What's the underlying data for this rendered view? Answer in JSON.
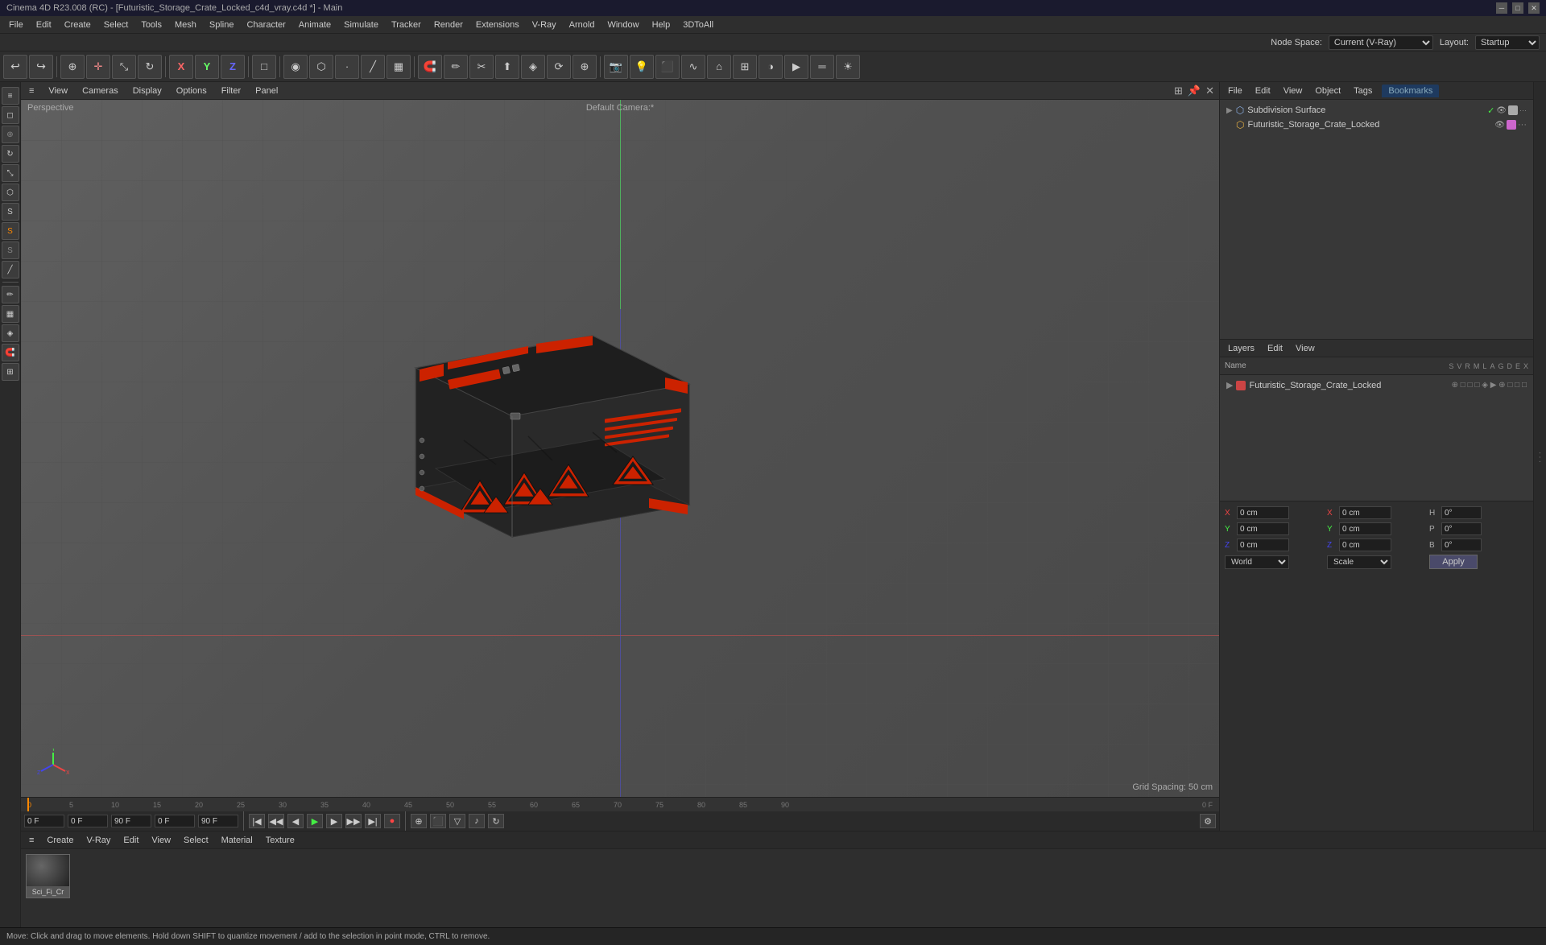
{
  "titleBar": {
    "title": "Cinema 4D R23.008 (RC) - [Futuristic_Storage_Crate_Locked_c4d_vray.c4d *] - Main",
    "controls": [
      "minimize",
      "maximize",
      "close"
    ]
  },
  "menuBar": {
    "items": [
      "File",
      "Edit",
      "Create",
      "Select",
      "Tools",
      "Mesh",
      "Spline",
      "Character",
      "Animate",
      "Simulate",
      "Tracker",
      "Render",
      "Extensions",
      "V-Ray",
      "Arnold",
      "Window",
      "Help",
      "3DToAll"
    ]
  },
  "nodeSpaceBar": {
    "label": "Node Space:",
    "current": "Current (V-Ray)",
    "layout_label": "Layout:",
    "layout_value": "Startup"
  },
  "viewport": {
    "perspective": "Perspective",
    "camera": "Default Camera:*",
    "menus": [
      "≡",
      "View",
      "Cameras",
      "Display",
      "Options",
      "Filter",
      "Panel"
    ],
    "gridSpacing": "Grid Spacing: 50 cm"
  },
  "objectManager": {
    "menus": [
      "File",
      "Edit",
      "View",
      "Object",
      "Tags",
      "Bookmarks"
    ],
    "items": [
      {
        "name": "Subdivision Surface",
        "type": "subdivision",
        "color": "#aaaaaa"
      },
      {
        "name": "Futuristic_Storage_Crate_Locked",
        "type": "mesh",
        "color": "#cc66cc"
      }
    ]
  },
  "layersPanel": {
    "title": "Layers",
    "menus": [
      "Layers",
      "Edit",
      "View"
    ],
    "columns": [
      "Name",
      "S",
      "V",
      "R",
      "M",
      "L",
      "A",
      "G",
      "D",
      "E",
      "X"
    ],
    "items": [
      {
        "name": "Futuristic_Storage_Crate_Locked",
        "color": "#cc4444"
      }
    ]
  },
  "materialBar": {
    "menus": [
      "Create",
      "V-Ray",
      "Edit",
      "View",
      "Select",
      "Material",
      "Texture"
    ],
    "materials": [
      {
        "name": "Sci_Fi_Cr",
        "preview": "dark_metal"
      }
    ]
  },
  "timeline": {
    "currentFrame": "0 F",
    "startFrame": "0 F",
    "endFrame": "90 F",
    "previewStart": "0 F",
    "previewEnd": "90 F",
    "marks": [
      0,
      5,
      10,
      15,
      20,
      25,
      30,
      35,
      40,
      45,
      50,
      55,
      60,
      65,
      70,
      75,
      80,
      85,
      90
    ]
  },
  "coordinates": {
    "x_pos": "0 cm",
    "y_pos": "0 cm",
    "z_pos": "0 cm",
    "x_rot": "0°",
    "y_rot": "0°",
    "z_rot": "0°",
    "h": "0°",
    "p": "0°",
    "b": "0°",
    "world_label": "World",
    "scale_label": "Scale",
    "apply_label": "Apply"
  },
  "statusBar": {
    "message": "Move: Click and drag to move elements. Hold down SHIFT to quantize movement / add to the selection in point mode, CTRL to remove."
  }
}
